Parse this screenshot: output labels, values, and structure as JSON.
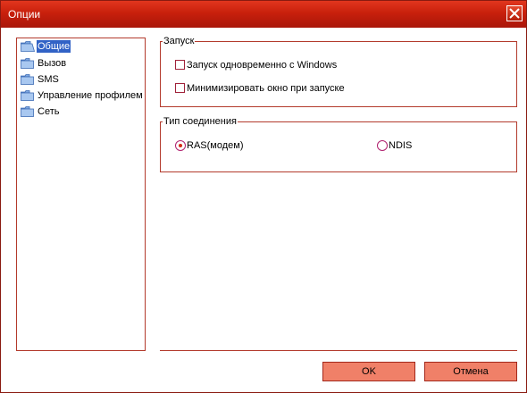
{
  "window": {
    "title": "Опции"
  },
  "tree": {
    "items": [
      {
        "label": "Общие",
        "selected": true,
        "icon": "folder-icon"
      },
      {
        "label": "Вызов",
        "icon": "folder-icon"
      },
      {
        "label": "SMS",
        "icon": "folder-icon"
      },
      {
        "label": "Управление профилем",
        "icon": "folder-icon"
      },
      {
        "label": "Сеть",
        "icon": "folder-icon"
      }
    ]
  },
  "startup": {
    "legend": "Запуск",
    "options": [
      {
        "label": "Запуск одновременно с Windows",
        "checked": false
      },
      {
        "label": "Минимизировать окно при запуске",
        "checked": false
      }
    ]
  },
  "connection": {
    "legend": "Тип соединения",
    "options": [
      {
        "label": "RAS(модем)",
        "selected": true
      },
      {
        "label": "NDIS",
        "selected": false
      }
    ]
  },
  "buttons": {
    "ok": "OK",
    "cancel": "Отмена"
  },
  "colors": {
    "titlebar": "#c8200c",
    "border": "#b33a2c",
    "button": "#f08068",
    "selection": "#3162c6"
  }
}
